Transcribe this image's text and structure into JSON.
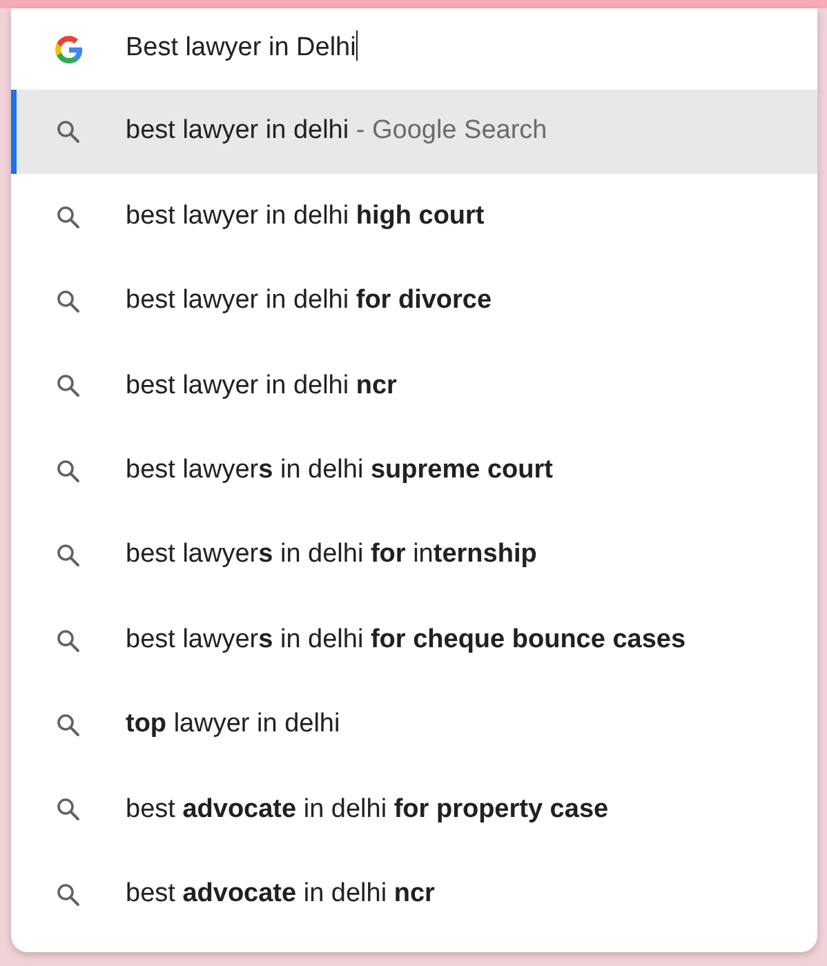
{
  "omnibox": {
    "value": "Best lawyer in Delhi"
  },
  "suggestions": [
    {
      "text": "best lawyer in delhi",
      "suffix": " - Google Search",
      "selected": true
    },
    {
      "text": "best lawyer in delhi **high court**",
      "selected": false
    },
    {
      "text": "best lawyer in delhi **for divorce**",
      "selected": false
    },
    {
      "text": "best lawyer in delhi **ncr**",
      "selected": false
    },
    {
      "text": "best lawyer**s** in delhi **supreme court**",
      "selected": false
    },
    {
      "text": "best lawyer**s** in delhi **for** in**ternship**",
      "selected": false
    },
    {
      "text": "best lawyer**s** in delhi **for cheque bounce cases**",
      "selected": false
    },
    {
      "text": "**top** lawyer in delhi",
      "selected": false
    },
    {
      "text": "best **advocate** in delhi **for property case**",
      "selected": false
    },
    {
      "text": "best **advocate** in delhi **ncr**",
      "selected": false
    }
  ]
}
